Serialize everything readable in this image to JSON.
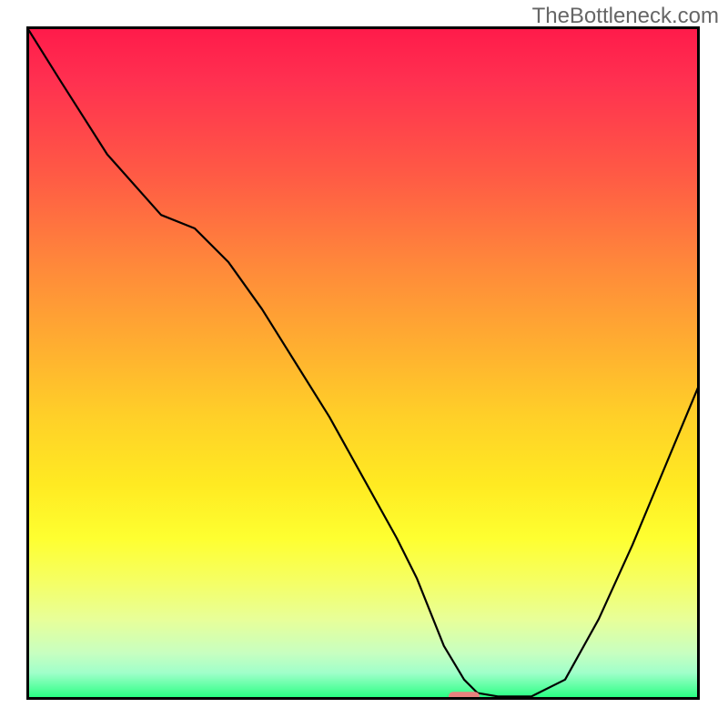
{
  "watermark": "TheBottleneck.com",
  "chart_data": {
    "type": "line",
    "title": "",
    "xlabel": "",
    "ylabel": "",
    "xlim": [
      0,
      100
    ],
    "ylim": [
      0,
      100
    ],
    "x": [
      0,
      5,
      12,
      20,
      25,
      30,
      35,
      40,
      45,
      50,
      55,
      58,
      60,
      62,
      65,
      67,
      70,
      75,
      80,
      85,
      90,
      95,
      100
    ],
    "y": [
      100,
      92,
      81,
      72,
      70,
      65,
      58,
      50,
      42,
      33,
      24,
      18,
      13,
      8,
      3,
      1,
      0.5,
      0.5,
      3,
      12,
      23,
      35,
      47
    ],
    "marker": {
      "x": 65,
      "y": 0.5,
      "color": "#e8817e",
      "shape": "rounded-rect"
    },
    "background_gradient": {
      "type": "vertical",
      "stops": [
        {
          "pos": 0,
          "color": "#ff1a4a"
        },
        {
          "pos": 50,
          "color": "#ffc028"
        },
        {
          "pos": 80,
          "color": "#feff30"
        },
        {
          "pos": 100,
          "color": "#1aff7a"
        }
      ]
    }
  }
}
